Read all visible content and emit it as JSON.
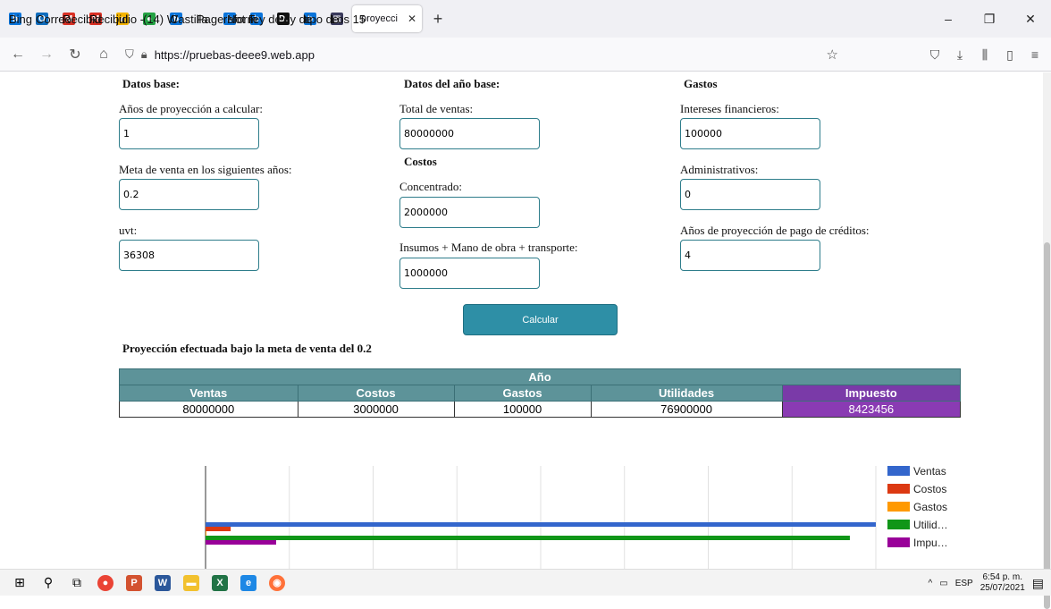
{
  "browser": {
    "tabs": [
      {
        "label": "Bing",
        "icon": "bing-icon",
        "color": "#0a74da",
        "glyph": "b"
      },
      {
        "label": "Correo",
        "icon": "outlook-icon",
        "color": "#0f6cbd",
        "glyph": "O"
      },
      {
        "label": "Recibid",
        "icon": "gmail-icon",
        "color": "#d93025",
        "glyph": "M"
      },
      {
        "label": "Recibid",
        "icon": "gmail-icon",
        "color": "#d93025",
        "glyph": "M"
      },
      {
        "label": "julio -",
        "icon": "drive-icon",
        "color": "#f4b400",
        "glyph": "▲"
      },
      {
        "label": "(14) W",
        "icon": "whatsapp-icon",
        "color": "#25a244",
        "glyph": "●"
      },
      {
        "label": "Castilla",
        "icon": "bing-icon",
        "color": "#0a74da",
        "glyph": "b"
      },
      {
        "label": "Page Not F",
        "icon": "blank-icon",
        "color": "#f0f0f4",
        "glyph": ""
      },
      {
        "label": "reform",
        "icon": "bing-icon",
        "color": "#0a74da",
        "glyph": "b"
      },
      {
        "label": "ley de f",
        "icon": "bing-icon",
        "color": "#0a74da",
        "glyph": "b"
      },
      {
        "label": "Ley de",
        "icon": "d-icon",
        "color": "#111111",
        "glyph": "D."
      },
      {
        "label": "tipo de",
        "icon": "bing-icon",
        "color": "#0a74da",
        "glyph": "b"
      },
      {
        "label": "Los 15",
        "icon": "page-icon",
        "color": "#3a3a5c",
        "glyph": "▦"
      }
    ],
    "active_tab": "proyecci",
    "url": "https://pruebas-deee9.web.app"
  },
  "form": {
    "col1": {
      "heading": "Datos base:",
      "fields": [
        {
          "label": "Años de proyección a calcular:",
          "value": "1"
        },
        {
          "label": "Meta de venta en los siguientes años:",
          "value": "0.2"
        },
        {
          "label": "uvt:",
          "value": "36308"
        }
      ]
    },
    "col2": {
      "heading": "Datos del año base:",
      "total_label": "Total de ventas:",
      "total_value": "80000000",
      "costos_heading": "Costos",
      "fields": [
        {
          "label": "Concentrado:",
          "value": "2000000"
        },
        {
          "label": "Insumos + Mano de obra + transporte:",
          "value": "1000000"
        }
      ]
    },
    "col3": {
      "heading": "Gastos",
      "fields": [
        {
          "label": "Intereses financieros:",
          "value": "100000"
        },
        {
          "label": "Administrativos:",
          "value": "0"
        },
        {
          "label": "Años de proyección de pago de créditos:",
          "value": "4"
        }
      ]
    },
    "calc_button": "Calcular"
  },
  "results": {
    "title": "Proyección efectuada bajo la meta de venta del 0.2",
    "group_header": "Año",
    "headers": [
      "Ventas",
      "Costos",
      "Gastos",
      "Utilidades",
      "Impuesto"
    ],
    "row": [
      "80000000",
      "3000000",
      "100000",
      "76900000",
      "8423456"
    ],
    "colors": {
      "header": "#5d9399",
      "impuesto": "#8a3bb3"
    }
  },
  "chart_data": {
    "type": "bar",
    "orientation": "horizontal",
    "categories": [
      ""
    ],
    "series": [
      {
        "name": "Ventas",
        "values": [
          80000000
        ],
        "color": "#3366cc"
      },
      {
        "name": "Costos",
        "values": [
          3000000
        ],
        "color": "#dc3912"
      },
      {
        "name": "Gastos",
        "values": [
          100000
        ],
        "color": "#ff9900"
      },
      {
        "name": "Utilid…",
        "values": [
          76900000
        ],
        "color": "#109618"
      },
      {
        "name": "Impu…",
        "values": [
          8423456
        ],
        "color": "#990099"
      }
    ],
    "xlim": [
      0,
      80000000
    ],
    "grid": true,
    "legend": "right"
  },
  "taskbar": {
    "lang": "ESP",
    "time": "6:54 p. m.",
    "date": "25/07/2021"
  }
}
